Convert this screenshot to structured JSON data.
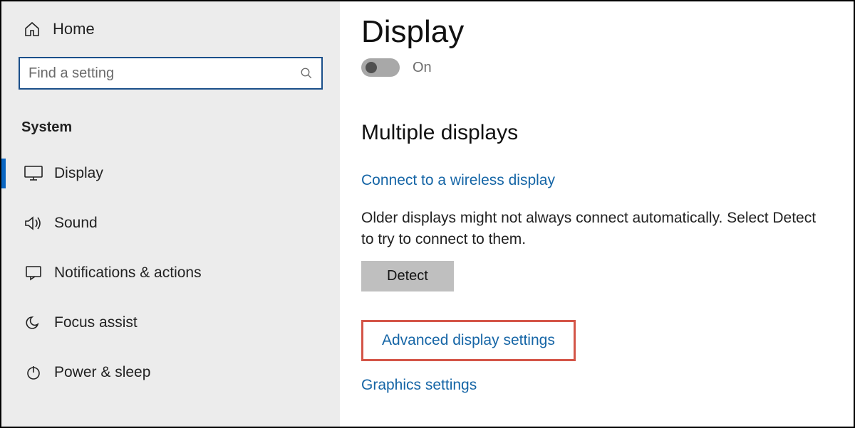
{
  "sidebar": {
    "home_label": "Home",
    "search_placeholder": "Find a setting",
    "category_label": "System",
    "items": [
      {
        "label": "Display"
      },
      {
        "label": "Sound"
      },
      {
        "label": "Notifications & actions"
      },
      {
        "label": "Focus assist"
      },
      {
        "label": "Power & sleep"
      }
    ]
  },
  "main": {
    "title": "Display",
    "toggle_label": "On",
    "section_heading": "Multiple displays",
    "wireless_link": "Connect to a wireless display",
    "older_displays_text": "Older displays might not always connect automatically. Select Detect to try to connect to them.",
    "detect_button": "Detect",
    "advanced_link": "Advanced display settings",
    "graphics_link": "Graphics settings"
  }
}
